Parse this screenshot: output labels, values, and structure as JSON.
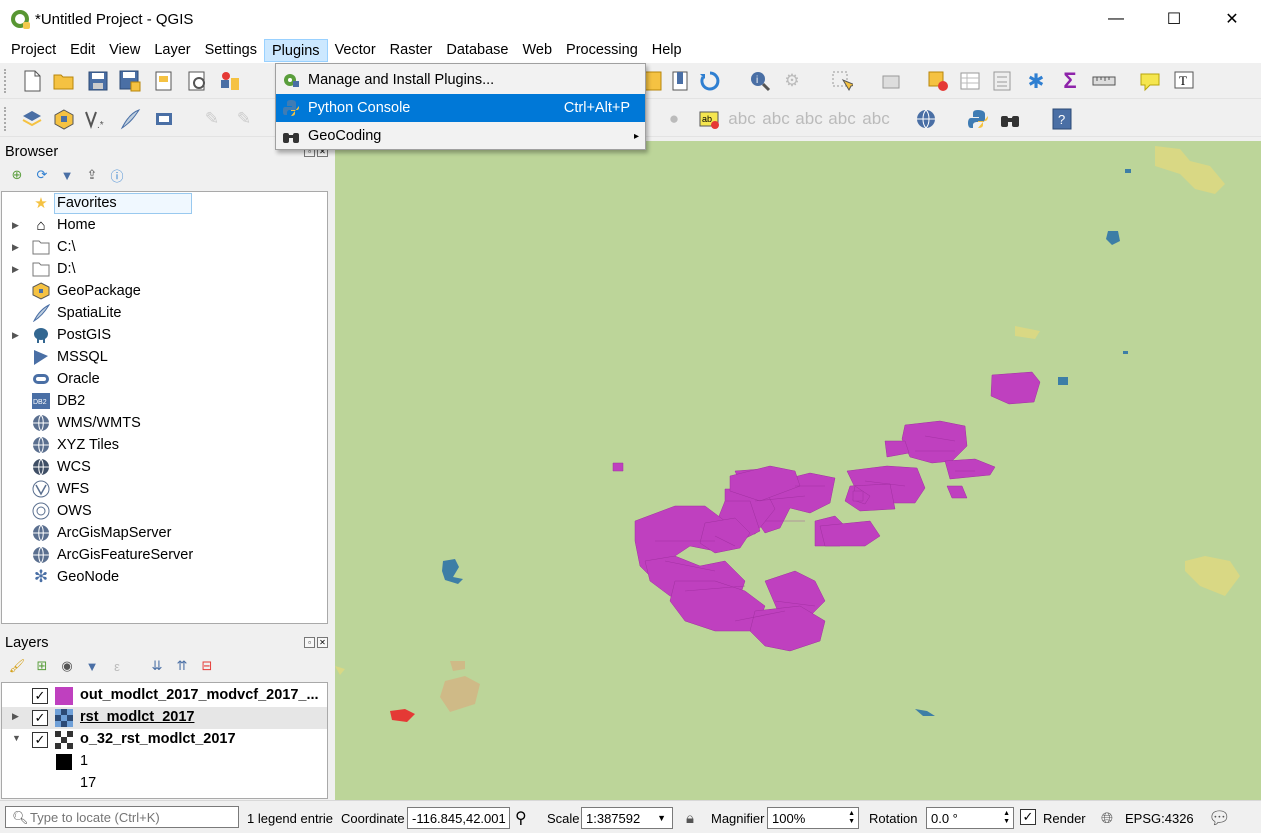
{
  "window": {
    "title": "*Untitled Project - QGIS",
    "minimize": "—",
    "maximize": "☐",
    "close": "✕"
  },
  "menubar": [
    "Project",
    "Edit",
    "View",
    "Layer",
    "Settings",
    "Plugins",
    "Vector",
    "Raster",
    "Database",
    "Web",
    "Processing",
    "Help"
  ],
  "plugins_menu": {
    "items": [
      {
        "label": "Manage and Install Plugins...",
        "shortcut": "",
        "icon": "plugin-gear-icon"
      },
      {
        "label": "Python Console",
        "shortcut": "Ctrl+Alt+P",
        "icon": "python-icon"
      },
      {
        "label": "GeoCoding",
        "shortcut": "",
        "icon": "binoculars-icon",
        "submenu": "▸"
      }
    ]
  },
  "browser": {
    "title": "Browser",
    "items": [
      {
        "label": "Favorites",
        "icon": "star-icon"
      },
      {
        "label": "Home",
        "icon": "home-icon"
      },
      {
        "label": "C:\\",
        "icon": "folder-icon"
      },
      {
        "label": "D:\\",
        "icon": "folder-icon"
      },
      {
        "label": "GeoPackage",
        "icon": "geopackage-icon"
      },
      {
        "label": "SpatiaLite",
        "icon": "feather-icon"
      },
      {
        "label": "PostGIS",
        "icon": "elephant-icon"
      },
      {
        "label": "MSSQL",
        "icon": "mssql-icon"
      },
      {
        "label": "Oracle",
        "icon": "oracle-icon"
      },
      {
        "label": "DB2",
        "icon": "db2-icon"
      },
      {
        "label": "WMS/WMTS",
        "icon": "globe-icon"
      },
      {
        "label": "XYZ Tiles",
        "icon": "globe-icon"
      },
      {
        "label": "WCS",
        "icon": "globe-icon"
      },
      {
        "label": "WFS",
        "icon": "globe-icon"
      },
      {
        "label": "OWS",
        "icon": "globe-icon"
      },
      {
        "label": "ArcGisMapServer",
        "icon": "globe-icon"
      },
      {
        "label": "ArcGisFeatureServer",
        "icon": "globe-icon"
      },
      {
        "label": "GeoNode",
        "icon": "geonode-icon"
      }
    ]
  },
  "layers": {
    "title": "Layers",
    "items": [
      {
        "label": "out_modlct_2017_modvcf_2017_...",
        "color": "#bf40bf"
      },
      {
        "label": "rst_modlct_2017"
      },
      {
        "label": "o_32_rst_modlct_2017"
      }
    ],
    "legend": [
      {
        "label": "1",
        "color": "#000000"
      },
      {
        "label": "17",
        "color": "#ffffff"
      }
    ]
  },
  "statusbar": {
    "locator_placeholder": "Type to locate (Ctrl+K)",
    "legend_entries": "1 legend entrie",
    "coordinate_label": "Coordinate",
    "coordinate_value": "-116.845,42.001",
    "scale_label": "Scale",
    "scale_value": "1:387592",
    "magnifier_label": "Magnifier",
    "magnifier_value": "100%",
    "rotation_label": "Rotation",
    "rotation_value": "0.0 °",
    "render_label": "Render",
    "crs": "EPSG:4326"
  },
  "colors": {
    "map_bg": "#bcd599",
    "polygons": "#bf40bf",
    "highlight": "#0078d7"
  }
}
